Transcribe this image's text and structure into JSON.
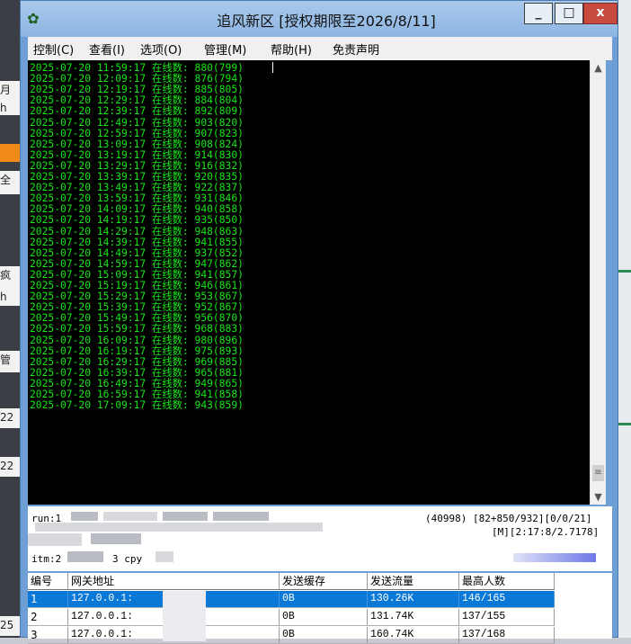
{
  "window": {
    "title": "追风新区 [授权期限至2026/8/11]",
    "controls": {
      "minimize": "_",
      "maximize": "□",
      "close": "x"
    }
  },
  "background_left_glyphs": [
    "月",
    "h",
    "全",
    "疯",
    "h",
    "管",
    "22",
    "22",
    "25"
  ],
  "menu": [
    "控制(C)",
    "查看(I)",
    "选项(O)",
    "管理(M)",
    "帮助(H)",
    "免责声明"
  ],
  "log_label": "在线数:",
  "log": [
    {
      "time": "2025-07-20 11:59:17",
      "count": "880(799)"
    },
    {
      "time": "2025-07-20 12:09:17",
      "count": "876(794)"
    },
    {
      "time": "2025-07-20 12:19:17",
      "count": "885(805)"
    },
    {
      "time": "2025-07-20 12:29:17",
      "count": "884(804)"
    },
    {
      "time": "2025-07-20 12:39:17",
      "count": "892(809)"
    },
    {
      "time": "2025-07-20 12:49:17",
      "count": "903(820)"
    },
    {
      "time": "2025-07-20 12:59:17",
      "count": "907(823)"
    },
    {
      "time": "2025-07-20 13:09:17",
      "count": "908(824)"
    },
    {
      "time": "2025-07-20 13:19:17",
      "count": "914(830)"
    },
    {
      "time": "2025-07-20 13:29:17",
      "count": "916(832)"
    },
    {
      "time": "2025-07-20 13:39:17",
      "count": "920(835)"
    },
    {
      "time": "2025-07-20 13:49:17",
      "count": "922(837)"
    },
    {
      "time": "2025-07-20 13:59:17",
      "count": "931(846)"
    },
    {
      "time": "2025-07-20 14:09:17",
      "count": "940(858)"
    },
    {
      "time": "2025-07-20 14:19:17",
      "count": "935(850)"
    },
    {
      "time": "2025-07-20 14:29:17",
      "count": "948(863)"
    },
    {
      "time": "2025-07-20 14:39:17",
      "count": "941(855)"
    },
    {
      "time": "2025-07-20 14:49:17",
      "count": "937(852)"
    },
    {
      "time": "2025-07-20 14:59:17",
      "count": "947(862)"
    },
    {
      "time": "2025-07-20 15:09:17",
      "count": "941(857)"
    },
    {
      "time": "2025-07-20 15:19:17",
      "count": "946(861)"
    },
    {
      "time": "2025-07-20 15:29:17",
      "count": "953(867)"
    },
    {
      "time": "2025-07-20 15:39:17",
      "count": "952(867)"
    },
    {
      "time": "2025-07-20 15:49:17",
      "count": "956(870)"
    },
    {
      "time": "2025-07-20 15:59:17",
      "count": "968(883)"
    },
    {
      "time": "2025-07-20 16:09:17",
      "count": "980(896)"
    },
    {
      "time": "2025-07-20 16:19:17",
      "count": "975(893)"
    },
    {
      "time": "2025-07-20 16:29:17",
      "count": "969(885)"
    },
    {
      "time": "2025-07-20 16:39:17",
      "count": "965(881)"
    },
    {
      "time": "2025-07-20 16:49:17",
      "count": "949(865)"
    },
    {
      "time": "2025-07-20 16:59:17",
      "count": "941(858)"
    },
    {
      "time": "2025-07-20 17:09:17",
      "count": "943(859)"
    }
  ],
  "status": {
    "run_prefix": "run:1",
    "counters": "(40998) [82+850/932][0/0/21]",
    "timing": "[M][2:17:8/2.7178]",
    "itm_prefix": "itm:2",
    "cpy_fragment": "3 cpy"
  },
  "table": {
    "headers": [
      "编号",
      "网关地址",
      "发送缓存",
      "发送流量",
      "最高人数"
    ],
    "rows": [
      {
        "id": "1",
        "gateway": "127.0.0.1:",
        "cache": "0B",
        "traffic": "130.26K",
        "peak": "146/165",
        "selected": true
      },
      {
        "id": "2",
        "gateway": "127.0.0.1:",
        "cache": "0B",
        "traffic": "131.74K",
        "peak": "137/155",
        "selected": false
      },
      {
        "id": "3",
        "gateway": "127.0.0.1:",
        "cache": "0B",
        "traffic": "160.74K",
        "peak": "137/168",
        "selected": false
      }
    ]
  },
  "colors": {
    "console_bg": "#000000",
    "console_text": "#17e617",
    "titlebar": "#8db5e2",
    "selection": "#0a78d7"
  }
}
